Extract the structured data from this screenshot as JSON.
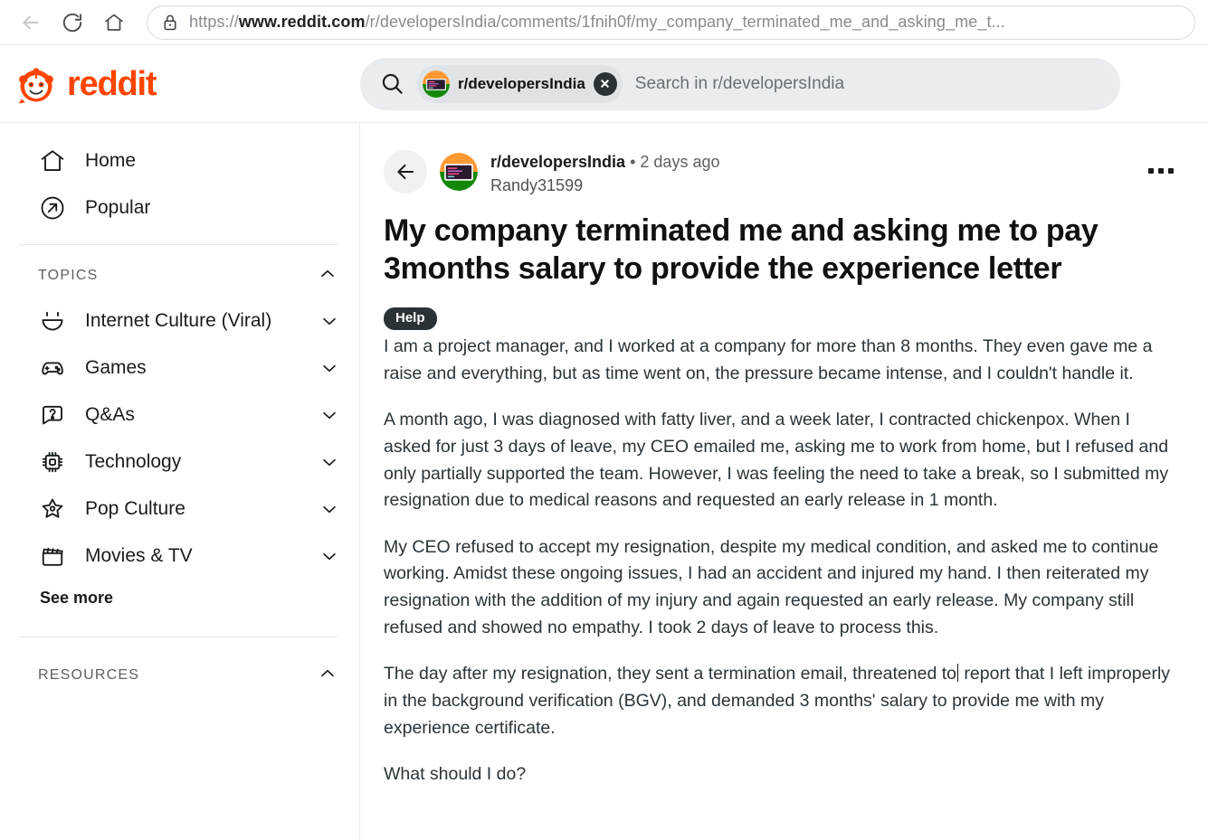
{
  "browser": {
    "url_prefix": "https://",
    "url_host": "www.reddit.com",
    "url_path": "/r/developersIndia/comments/1fnih0f/my_company_terminated_me_and_asking_me_t...",
    "back_icon": "back-arrow-icon",
    "reload_icon": "reload-icon",
    "home_icon": "home-icon",
    "lock_icon": "lock-icon"
  },
  "header": {
    "logo_text": "reddit",
    "logo_color": "#ff4500",
    "search": {
      "icon": "search-icon",
      "chip_label": "r/developersIndia",
      "chip_close_icon": "close-circle-icon",
      "placeholder": "Search in r/developersIndia"
    }
  },
  "sidebar": {
    "primary": [
      {
        "label": "Home",
        "icon": "home-icon"
      },
      {
        "label": "Popular",
        "icon": "arrow-up-right-circle-icon"
      }
    ],
    "topics_section": {
      "title": "TOPICS",
      "collapse_icon": "chevron-up-icon",
      "items": [
        {
          "label": "Internet Culture (Viral)",
          "icon": "smiley-face-icon",
          "chevron": "chevron-down-icon"
        },
        {
          "label": "Games",
          "icon": "game-controller-icon",
          "chevron": "chevron-down-icon"
        },
        {
          "label": "Q&As",
          "icon": "question-bubble-icon",
          "chevron": "chevron-down-icon"
        },
        {
          "label": "Technology",
          "icon": "cpu-chip-icon",
          "chevron": "chevron-down-icon"
        },
        {
          "label": "Pop Culture",
          "icon": "star-icon",
          "chevron": "chevron-down-icon"
        },
        {
          "label": "Movies & TV",
          "icon": "clapperboard-icon",
          "chevron": "chevron-down-icon"
        }
      ],
      "see_more": "See more"
    },
    "resources_section": {
      "title": "RESOURCES",
      "collapse_icon": "chevron-up-icon"
    }
  },
  "post": {
    "back_icon": "back-arrow-icon",
    "avatar": "developersindia-avatar",
    "subreddit": "r/developersIndia",
    "separator": "•",
    "timestamp": "2 days ago",
    "author": "Randy31599",
    "overflow_icon": "more-options-icon",
    "title": "My company terminated me and asking me to pay 3months salary to provide the experience letter",
    "flair": "Help",
    "paragraphs": [
      "I am a project manager, and I worked at a company for more than 8 months. They even gave me a raise and everything, but as time went on, the pressure became intense, and I couldn't handle it.",
      "A month ago, I was diagnosed with fatty liver, and a week later, I contracted chickenpox. When I asked for just 3 days of leave, my CEO emailed me, asking me to work from home, but I refused and only partially supported the team. However, I was feeling the need to take a break, so I submitted my resignation due to medical reasons and requested an early release in 1 month.",
      "My CEO refused to accept my resignation, despite my medical condition, and asked me to continue working. Amidst these ongoing issues, I had an accident and injured my hand. I then reiterated my resignation with the addition of my injury and again requested an early release. My company still refused and showed no empathy. I took 2 days of leave to process this.",
      "What should I do?"
    ],
    "paragraph_with_caret": {
      "before": "The day after my resignation, they sent a termination email, threatened to",
      "after": " report that I left improperly in the background verification (BGV), and demanded 3 months' salary to provide me with my experience certificate."
    }
  }
}
